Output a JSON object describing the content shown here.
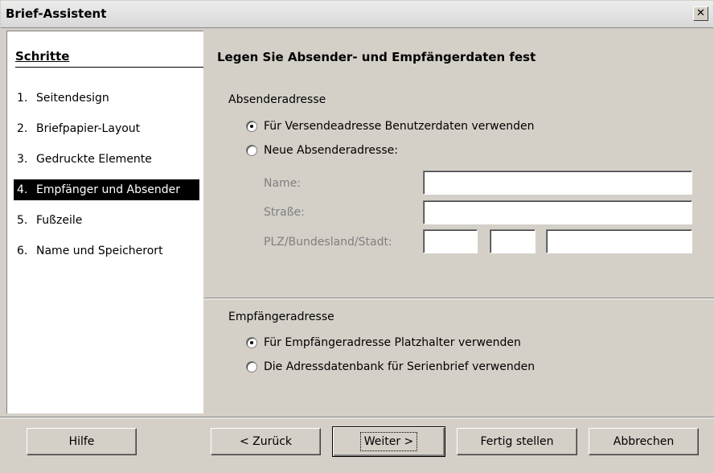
{
  "window": {
    "title": "Brief-Assistent",
    "close_glyph": "✕"
  },
  "sidebar": {
    "header": "Schritte",
    "steps": [
      {
        "num": "1.",
        "label": "Seitendesign"
      },
      {
        "num": "2.",
        "label": "Briefpapier-Layout"
      },
      {
        "num": "3.",
        "label": "Gedruckte Elemente"
      },
      {
        "num": "4.",
        "label": "Empfänger und Absender"
      },
      {
        "num": "5.",
        "label": "Fußzeile"
      },
      {
        "num": "6.",
        "label": "Name und Speicherort"
      }
    ]
  },
  "main": {
    "title": "Legen Sie Absender- und Empfängerdaten fest",
    "sender": {
      "label": "Absenderadresse",
      "option1": "Für Versendeadresse Benutzerdaten verwenden",
      "option2": "Neue Absenderadresse:",
      "name_label": "Name:",
      "street_label": "Straße:",
      "zip_label": "PLZ/Bundesland/Stadt:",
      "name_value": "",
      "street_value": "",
      "zip_value": "",
      "state_value": "",
      "city_value": ""
    },
    "recipient": {
      "label": "Empfängeradresse",
      "option1": "Für Empfängeradresse Platzhalter verwenden",
      "option2": "Die Adressdatenbank für Serienbrief verwenden"
    }
  },
  "buttons": {
    "help": "Hilfe",
    "back": "< Zurück",
    "next": "Weiter >",
    "finish": "Fertig stellen",
    "cancel": "Abbrechen"
  }
}
